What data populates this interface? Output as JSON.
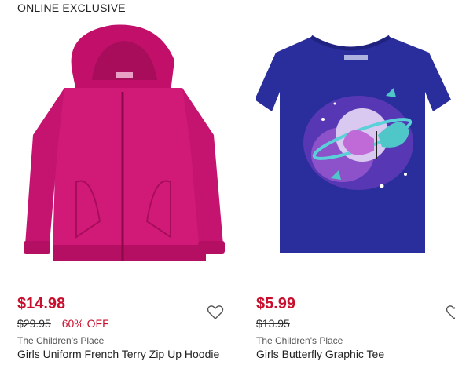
{
  "badge": "ONLINE EXCLUSIVE",
  "products": [
    {
      "image": "pink-zip-hoodie",
      "price": "$14.98",
      "original_price": "$29.95",
      "discount": "60% OFF",
      "brand": "The Children's Place",
      "title": "Girls Uniform French Terry Zip Up Hoodie",
      "color": "#d11a78"
    },
    {
      "image": "navy-butterfly-tee",
      "price": "$5.99",
      "original_price": "$13.95",
      "discount": "",
      "brand": "The Children's Place",
      "title": "Girls Butterfly Graphic Tee",
      "color": "#2a2d9c"
    }
  ],
  "icons": {
    "favorite": "heart-outline-icon"
  },
  "colors": {
    "sale": "#c8102e",
    "text": "#222222",
    "brand": "#555555"
  }
}
